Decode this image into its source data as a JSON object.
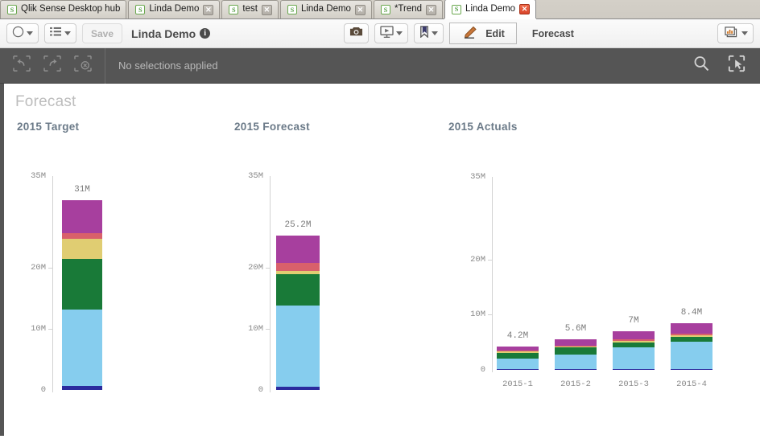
{
  "window": {
    "tabs": [
      {
        "label": "Qlik Sense Desktop hub",
        "closable": false,
        "active": false,
        "icon": "qlik-logo-icon"
      },
      {
        "label": "Linda Demo",
        "closable": true,
        "active": false,
        "icon": "qlik-logo-icon"
      },
      {
        "label": "test",
        "closable": true,
        "active": false,
        "icon": "qlik-logo-icon"
      },
      {
        "label": "Linda Demo",
        "closable": true,
        "active": false,
        "icon": "qlik-logo-icon"
      },
      {
        "label": "*Trend",
        "closable": true,
        "active": false,
        "icon": "qlik-logo-icon"
      },
      {
        "label": "Linda Demo",
        "closable": true,
        "active": true,
        "icon": "qlik-logo-icon"
      }
    ],
    "close_glyph": "✕"
  },
  "toolbar": {
    "nav_icon": "compass-icon",
    "sheets_icon": "sheet-list-icon",
    "save_label": "Save",
    "app_title": "Linda Demo",
    "info_glyph": "i",
    "snapshot_icon": "camera-icon",
    "story_icon": "storytelling-icon",
    "bookmark_icon": "bookmark-icon",
    "edit_icon": "pencil-icon",
    "edit_label": "Edit",
    "sheet_name": "Forecast",
    "sheets_selector_icon": "sheets-chart-icon"
  },
  "selection_bar": {
    "step_back_icon": "step-back-icon",
    "step_forward_icon": "step-forward-icon",
    "clear_all_icon": "clear-selections-icon",
    "status_text": "No selections applied",
    "search_icon": "search-icon",
    "selection_tool_icon": "selection-tool-icon"
  },
  "sheet": {
    "title": "Forecast"
  },
  "colors": {
    "segment_purple": "#a73f9e",
    "segment_salmon": "#d9606b",
    "segment_khaki": "#e0cd72",
    "segment_green": "#197a38",
    "segment_lightblue": "#86cdee",
    "segment_darkblue": "#2b2b9e",
    "axis": "#d2d2d2",
    "tick_text": "#8a8a8a",
    "chart_title": "#6b7a88",
    "sheet_title": "#bdbdbd",
    "chrome_dark": "#555555"
  },
  "chart_data": [
    {
      "type": "bar",
      "title": "2015 Target",
      "stacked": true,
      "xlabel": "",
      "ylabel": "",
      "ylim": [
        0,
        35
      ],
      "yticks": [
        0,
        10,
        20,
        35
      ],
      "ytick_labels": [
        "0",
        "10M",
        "20M",
        "35M"
      ],
      "grid": false,
      "legend": "none",
      "categories": [
        ""
      ],
      "bar_totals": [
        31
      ],
      "bar_total_labels": [
        "31M"
      ],
      "series": [
        {
          "name": "segment-darkblue",
          "color": "#2b2b9e",
          "values": [
            0.6
          ]
        },
        {
          "name": "segment-lightblue",
          "color": "#86cdee",
          "values": [
            12.6
          ]
        },
        {
          "name": "segment-green",
          "color": "#197a38",
          "values": [
            8.2
          ]
        },
        {
          "name": "segment-khaki",
          "color": "#e0cd72",
          "values": [
            3.3
          ]
        },
        {
          "name": "segment-salmon",
          "color": "#d9606b",
          "values": [
            0.9
          ]
        },
        {
          "name": "segment-purple",
          "color": "#a73f9e",
          "values": [
            5.4
          ]
        }
      ]
    },
    {
      "type": "bar",
      "title": "2015 Forecast",
      "stacked": true,
      "xlabel": "",
      "ylabel": "",
      "ylim": [
        0,
        35
      ],
      "yticks": [
        0,
        10,
        20,
        35
      ],
      "ytick_labels": [
        "0",
        "10M",
        "20M",
        "35M"
      ],
      "grid": false,
      "legend": "none",
      "categories": [
        ""
      ],
      "bar_totals": [
        25.2
      ],
      "bar_total_labels": [
        "25.2M"
      ],
      "series": [
        {
          "name": "segment-darkblue",
          "color": "#2b2b9e",
          "values": [
            0.5
          ]
        },
        {
          "name": "segment-lightblue",
          "color": "#86cdee",
          "values": [
            13.3
          ]
        },
        {
          "name": "segment-green",
          "color": "#197a38",
          "values": [
            5.2
          ]
        },
        {
          "name": "segment-khaki",
          "color": "#e0cd72",
          "values": [
            0.5
          ]
        },
        {
          "name": "segment-salmon",
          "color": "#d9606b",
          "values": [
            1.3
          ]
        },
        {
          "name": "segment-purple",
          "color": "#a73f9e",
          "values": [
            4.4
          ]
        }
      ]
    },
    {
      "type": "bar",
      "title": "2015 Actuals",
      "stacked": true,
      "xlabel": "",
      "ylabel": "",
      "ylim": [
        0,
        35
      ],
      "yticks": [
        0,
        10,
        20,
        35
      ],
      "ytick_labels": [
        "0",
        "10M",
        "20M",
        "35M"
      ],
      "grid": false,
      "legend": "none",
      "categories": [
        "2015-1",
        "2015-2",
        "2015-3",
        "2015-4"
      ],
      "bar_totals": [
        4.2,
        5.6,
        7.0,
        8.4
      ],
      "bar_total_labels": [
        "4.2M",
        "5.6M",
        "7M",
        "8.4M"
      ],
      "series": [
        {
          "name": "segment-darkblue",
          "color": "#2b2b9e",
          "values": [
            0.12,
            0.15,
            0.18,
            0.2
          ]
        },
        {
          "name": "segment-lightblue",
          "color": "#86cdee",
          "values": [
            1.9,
            2.6,
            3.9,
            4.9
          ]
        },
        {
          "name": "segment-green",
          "color": "#197a38",
          "values": [
            1.1,
            1.3,
            0.9,
            0.9
          ]
        },
        {
          "name": "segment-khaki",
          "color": "#e0cd72",
          "values": [
            0.18,
            0.15,
            0.22,
            0.2
          ]
        },
        {
          "name": "segment-salmon",
          "color": "#d9606b",
          "values": [
            0.2,
            0.2,
            0.3,
            0.4
          ]
        },
        {
          "name": "segment-purple",
          "color": "#a73f9e",
          "values": [
            0.7,
            1.2,
            1.5,
            1.8
          ]
        }
      ]
    }
  ]
}
